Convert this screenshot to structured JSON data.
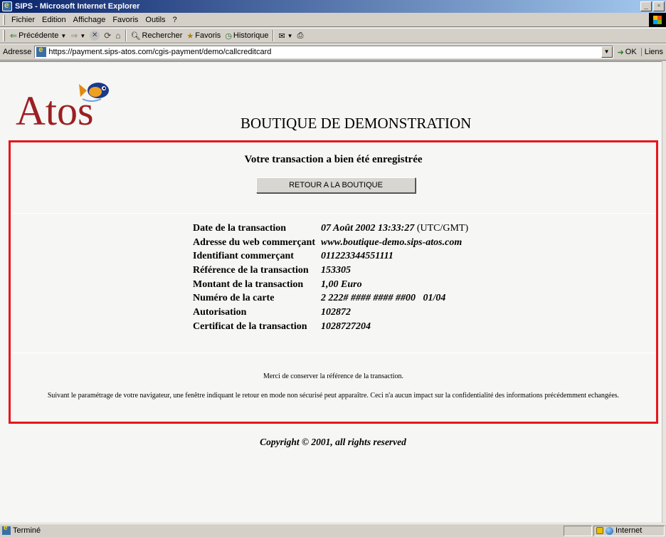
{
  "window": {
    "title": "SIPS - Microsoft Internet Explorer",
    "controls": [
      "_",
      "8",
      "x"
    ]
  },
  "menu": [
    "Fichier",
    "Edition",
    "Affichage",
    "Favoris",
    "Outils",
    "?"
  ],
  "toolbar": {
    "back_label": "Précédente",
    "search_label": "Rechercher",
    "favorites_label": "Favoris",
    "history_label": "Historique"
  },
  "address": {
    "label": "Adresse",
    "url": "https://payment.sips-atos.com/cgis-payment/demo/callcreditcard",
    "go_label": "OK",
    "links_label": "Liens"
  },
  "page": {
    "logo_text": "Atos",
    "shop_title": "BOUTIQUE DE DEMONSTRATION",
    "heading": "Votre transaction a bien été enregistrée",
    "return_button": "RETOUR A LA BOUTIQUE",
    "details": [
      {
        "key": "Date de la transaction",
        "value": "07 Août 2002 13:33:27",
        "suffix": "(UTC/GMT)"
      },
      {
        "key": "Adresse du web commerçant",
        "value": "www.boutique-demo.sips-atos.com",
        "suffix": ""
      },
      {
        "key": "Identifiant commerçant",
        "value": "011223344551111",
        "suffix": ""
      },
      {
        "key": "Référence de la transaction",
        "value": "153305",
        "suffix": ""
      },
      {
        "key": "Montant de la transaction",
        "value": "1,00 Euro",
        "suffix": ""
      },
      {
        "key": "Numéro de la carte",
        "value": "2 222# #### #### ##00   01/04",
        "suffix": ""
      },
      {
        "key": "Autorisation",
        "value": "102872",
        "suffix": ""
      },
      {
        "key": "Certificat de la transaction",
        "value": "1028727204",
        "suffix": ""
      }
    ],
    "note_keep_reference": "Merci de conserver la référence de la transaction.",
    "note_security": "Suivant le paramétrage de votre navigateur, une fenêtre indiquant le retour en mode non sécurisé peut apparaître. Ceci n'a aucun impact sur la confidentialité des informations précédemment echangées.",
    "copyright": "Copyright © 2001, all rights reserved"
  },
  "status": {
    "text": "Terminé",
    "zone": "Internet"
  },
  "colors": {
    "frame_border": "#e8141c",
    "logo": "#9b1f23",
    "titlebar_start": "#0a246a"
  }
}
